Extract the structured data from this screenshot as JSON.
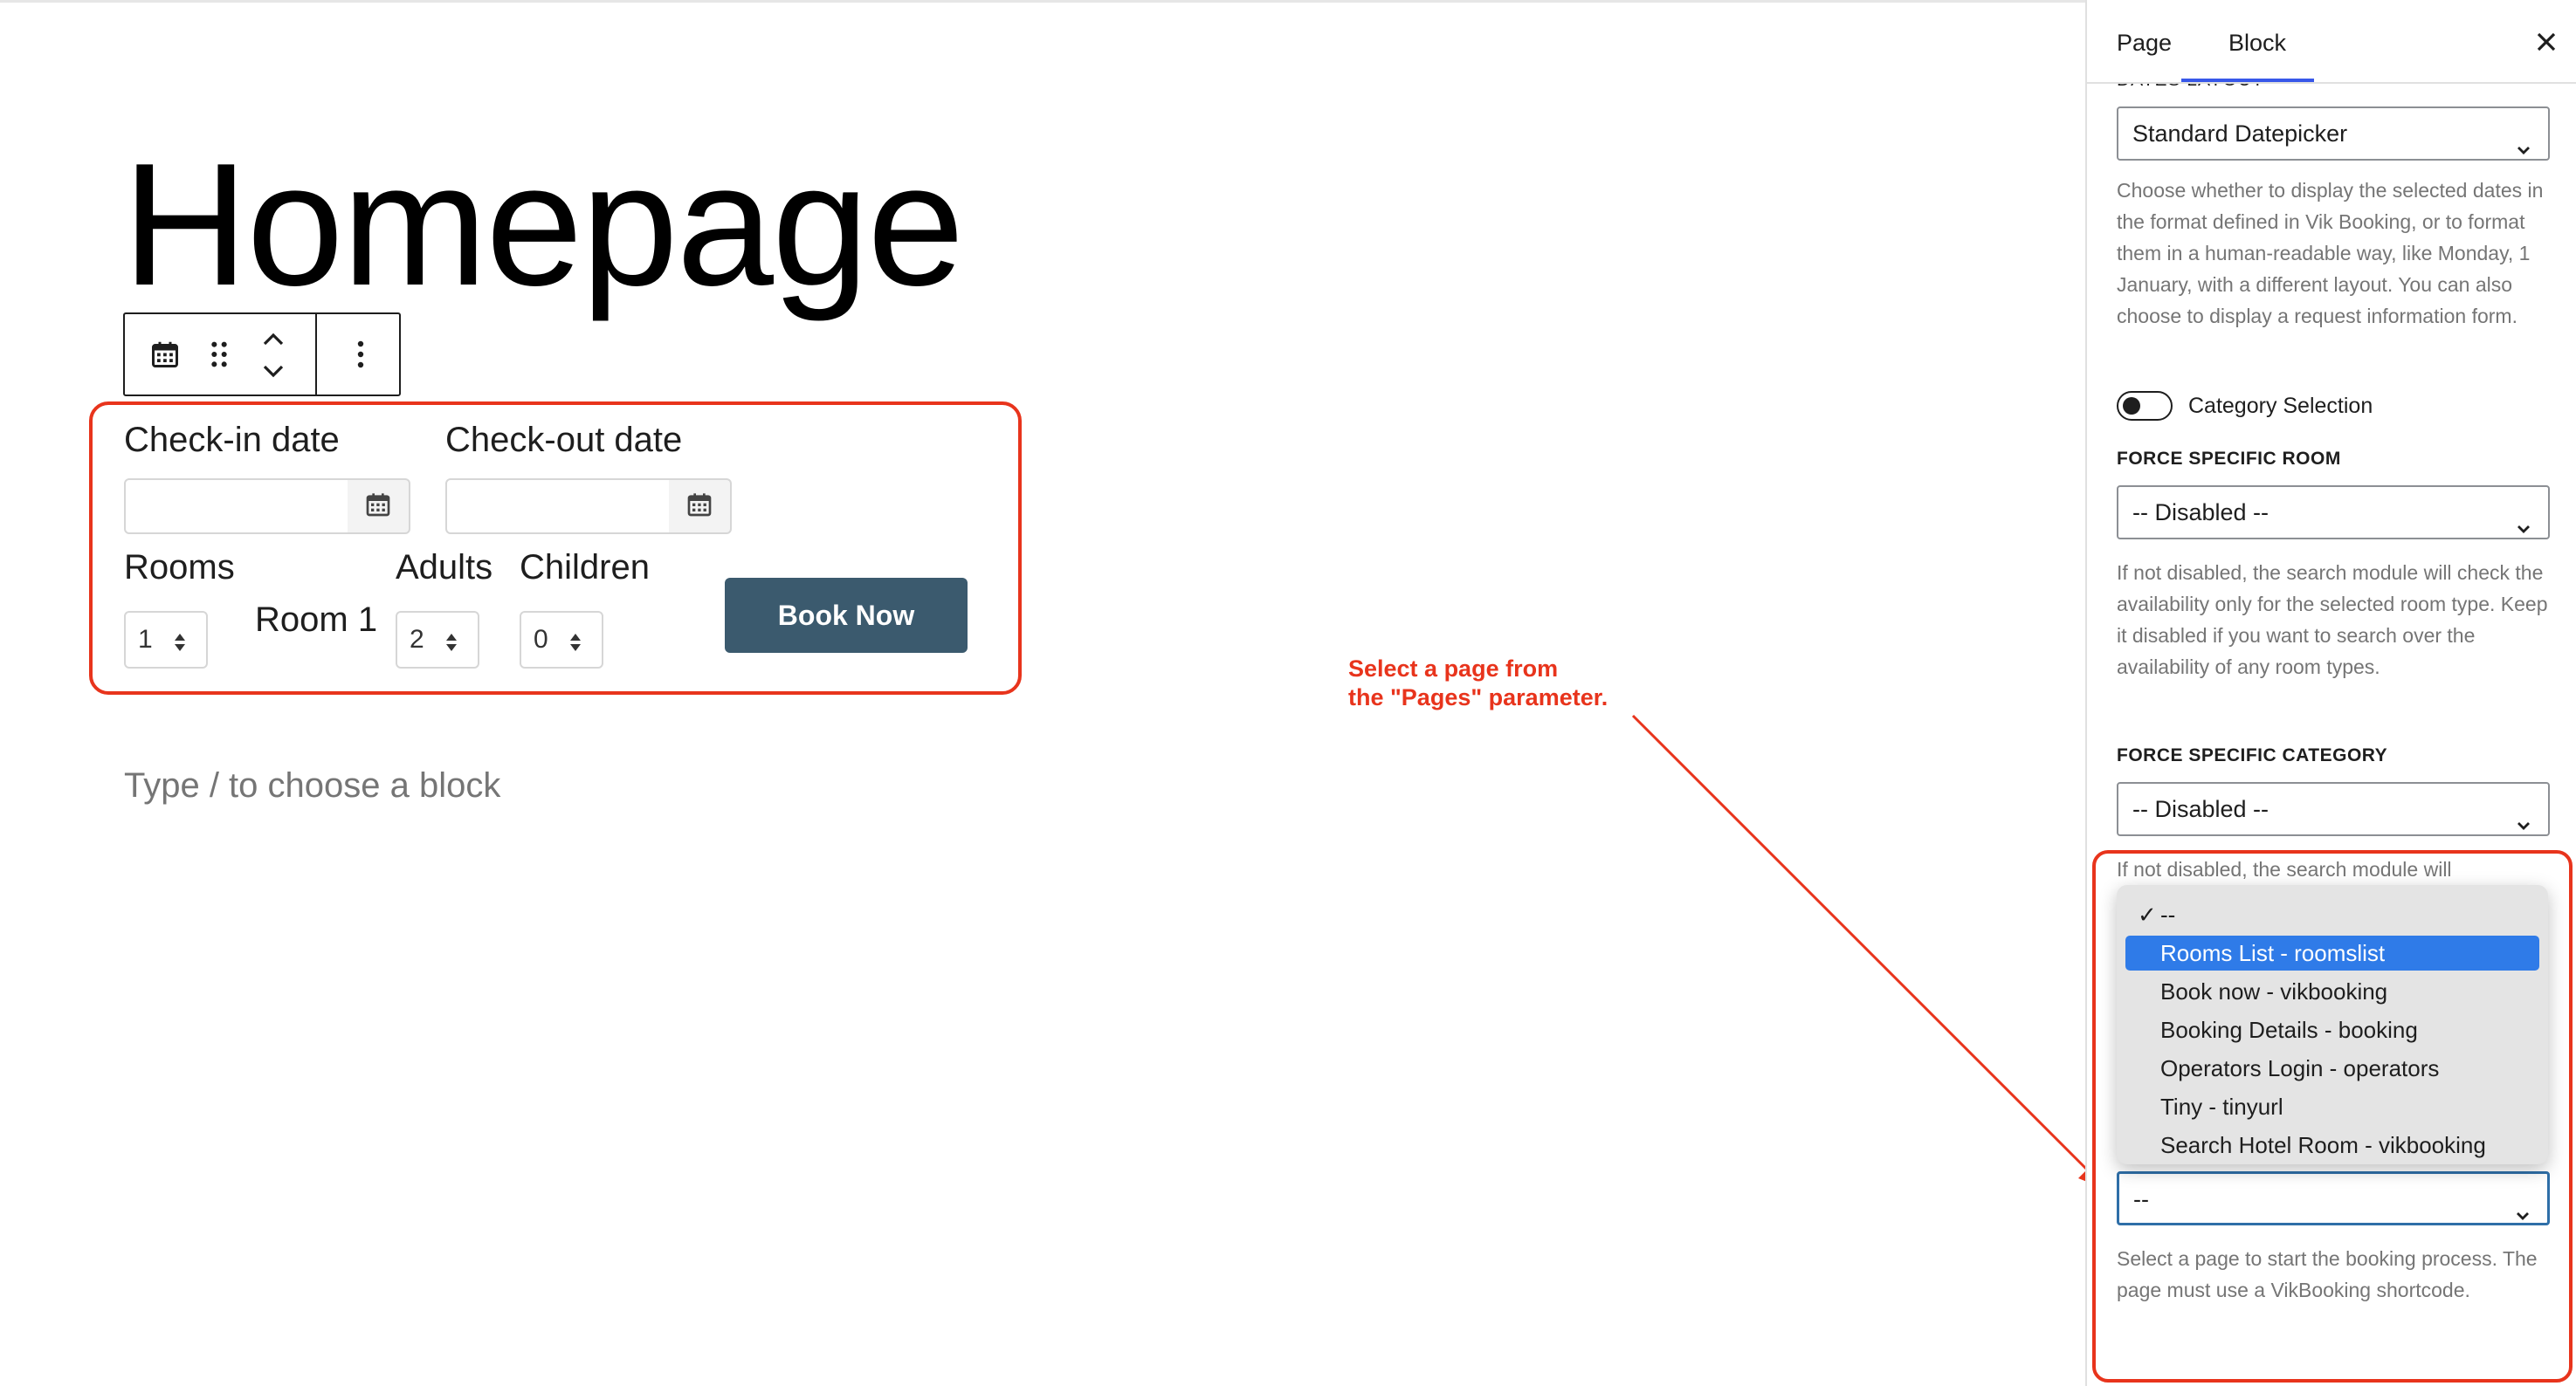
{
  "editor": {
    "page_title": "Homepage",
    "type_hint": "Type / to choose a block"
  },
  "search_form": {
    "checkin_label": "Check-in date",
    "checkout_label": "Check-out date",
    "rooms_label": "Rooms",
    "room_name": "Room 1",
    "adults_label": "Adults",
    "children_label": "Children",
    "rooms_value": "1",
    "adults_value": "2",
    "children_value": "0",
    "book_button": "Book Now"
  },
  "annotation": {
    "line1": "Select a page from",
    "line2": "the \"Pages\" parameter.",
    "color": "#e8341c"
  },
  "sidebar": {
    "tabs": [
      {
        "label": "Page",
        "active": false
      },
      {
        "label": "Block",
        "active": true
      }
    ],
    "clipped_label": "DATES LAYOUT",
    "dates_layout_value": "Standard Datepicker",
    "dates_layout_help": "Choose whether to display the selected dates in the format defined in Vik Booking, or to format them in a human-readable way, like Monday, 1 January, with a different layout. You can also choose to display a request information form.",
    "category_toggle_label": "Category Selection",
    "force_room_heading": "FORCE SPECIFIC ROOM",
    "force_room_value": "-- Disabled --",
    "force_room_help": "If not disabled, the search module will check the availability only for the selected room type. Keep it disabled if you want to search over the availability of any room types.",
    "force_category_heading": "FORCE SPECIFIC CATEGORY",
    "force_category_value": "-- Disabled --",
    "force_category_help_clipped": "If not disabled, the search module will",
    "pages_value": "--",
    "pages_help": "Select a page to start the booking process. The page must use a VikBooking shortcode."
  },
  "pages_dropdown": {
    "options": [
      {
        "label": "--",
        "checked": true,
        "highlighted": false
      },
      {
        "label": "Rooms List - roomslist",
        "checked": false,
        "highlighted": true
      },
      {
        "label": "Book now - vikbooking",
        "checked": false,
        "highlighted": false
      },
      {
        "label": "Booking Details - booking",
        "checked": false,
        "highlighted": false
      },
      {
        "label": "Operators Login - operators",
        "checked": false,
        "highlighted": false
      },
      {
        "label": "Tiny - tinyurl",
        "checked": false,
        "highlighted": false
      },
      {
        "label": "Search Hotel Room - vikbooking",
        "checked": false,
        "highlighted": false
      }
    ]
  },
  "colors": {
    "highlight_red": "#e8341c",
    "button_bg": "#3b5a6e",
    "selection_blue": "#2f7be8",
    "tab_underline": "#3858e9"
  }
}
